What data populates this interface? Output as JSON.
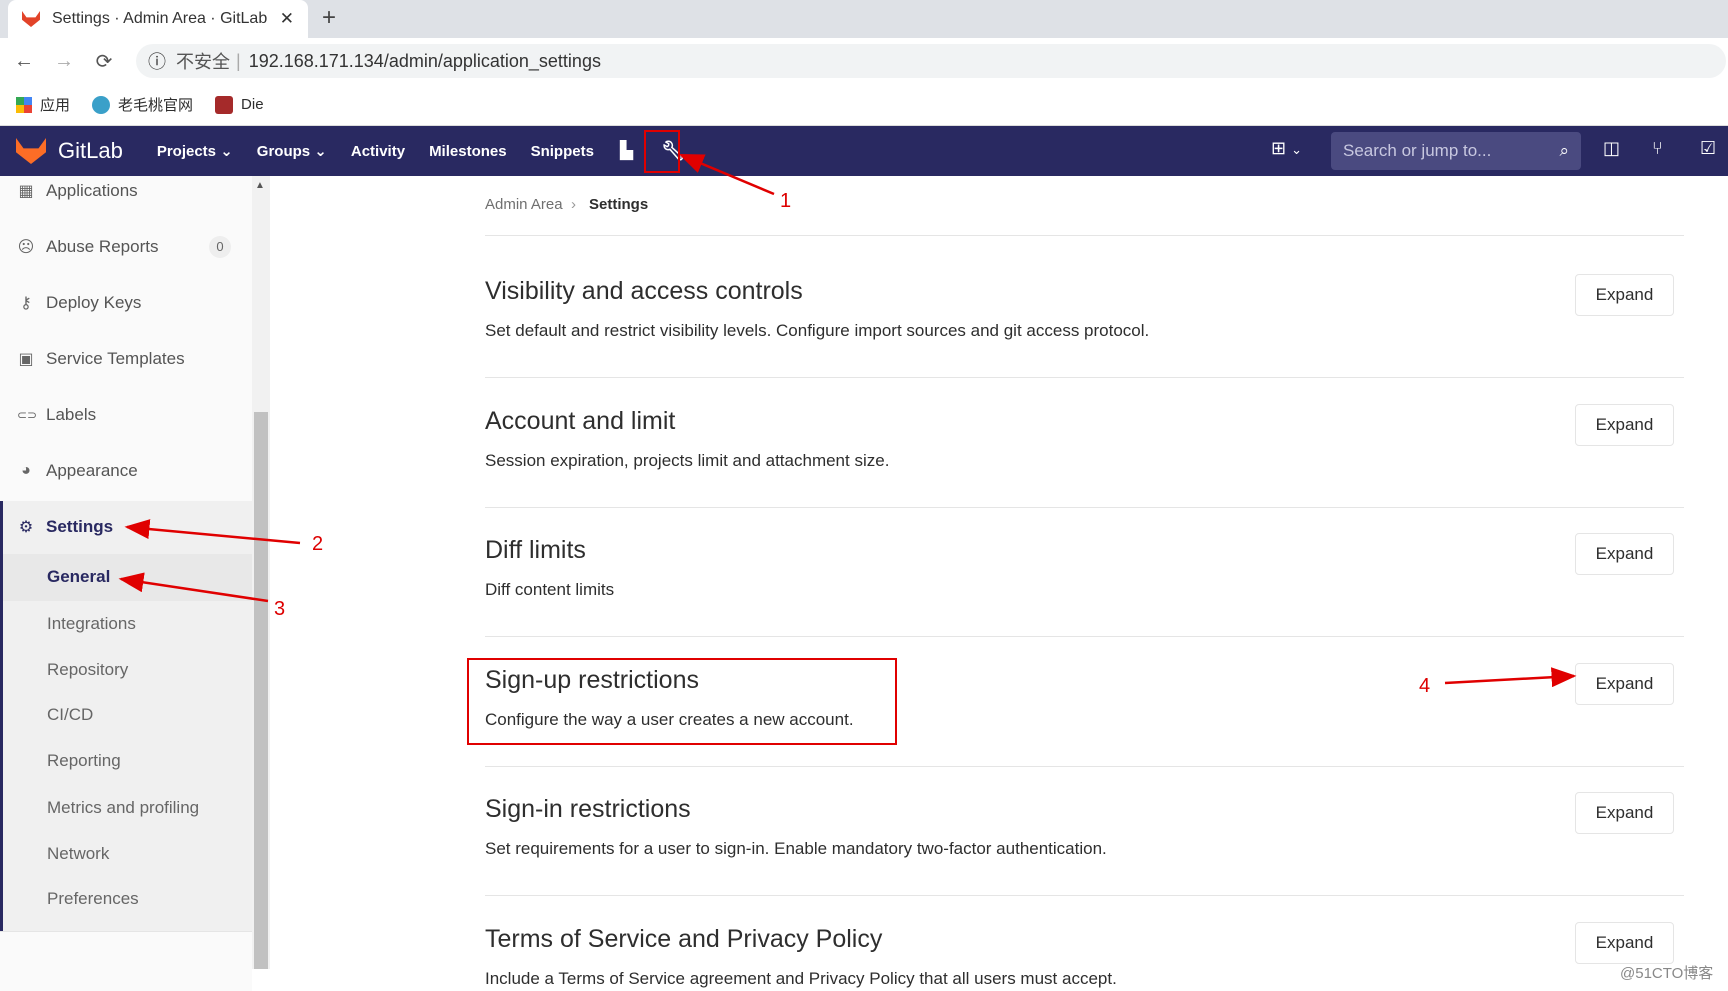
{
  "browser": {
    "tab_title": "Settings · Admin Area · GitLab",
    "close": "✕",
    "new_tab": "+",
    "back": "←",
    "forward": "→",
    "reload": "⟳",
    "security_icon": "ⓘ",
    "security_label": "不安全",
    "url": "192.168.171.134/admin/application_settings",
    "bookmarks": [
      {
        "label": "应用",
        "icon": "apps-grid-icon"
      },
      {
        "label": "老毛桃官网",
        "icon": "site-icon"
      },
      {
        "label": "Die",
        "icon": "die-icon"
      }
    ]
  },
  "navbar": {
    "brand": "GitLab",
    "items": [
      {
        "label": "Projects",
        "caret": "⌄"
      },
      {
        "label": "Groups",
        "caret": "⌄"
      },
      {
        "label": "Activity"
      },
      {
        "label": "Milestones"
      },
      {
        "label": "Snippets"
      }
    ],
    "search_placeholder": "Search or jump to...",
    "search_icon": "⌕",
    "new_icon": "⊞",
    "new_caret": "⌄"
  },
  "sidebar": {
    "items": [
      {
        "label": "Applications",
        "icon": "▦"
      },
      {
        "label": "Abuse Reports",
        "icon": "☹",
        "badge": "0"
      },
      {
        "label": "Deploy Keys",
        "icon": "⚷"
      },
      {
        "label": "Service Templates",
        "icon": "▣"
      },
      {
        "label": "Labels",
        "icon": "⊂⊃"
      },
      {
        "label": "Appearance",
        "icon": "◕"
      },
      {
        "label": "Settings",
        "icon": "⚙"
      }
    ],
    "subitems": [
      "General",
      "Integrations",
      "Repository",
      "CI/CD",
      "Reporting",
      "Metrics and profiling",
      "Network",
      "Preferences"
    ],
    "active_subitem": "General",
    "scroll_up": "▲"
  },
  "breadcrumb": {
    "parent": "Admin Area",
    "separator": "›",
    "current": "Settings"
  },
  "sections": [
    {
      "title": "Visibility and access controls",
      "description": "Set default and restrict visibility levels. Configure import sources and git access protocol.",
      "button": "Expand"
    },
    {
      "title": "Account and limit",
      "description": "Session expiration, projects limit and attachment size.",
      "button": "Expand"
    },
    {
      "title": "Diff limits",
      "description": "Diff content limits",
      "button": "Expand"
    },
    {
      "title": "Sign-up restrictions",
      "description": "Configure the way a user creates a new account.",
      "button": "Expand"
    },
    {
      "title": "Sign-in restrictions",
      "description": "Set requirements for a user to sign-in. Enable mandatory two-factor authentication.",
      "button": "Expand"
    },
    {
      "title": "Terms of Service and Privacy Policy",
      "description": "Include a Terms of Service agreement and Privacy Policy that all users must accept.",
      "button": "Expand"
    }
  ],
  "annotations": {
    "labels": [
      "1",
      "2",
      "3",
      "4"
    ],
    "color": "#e00000"
  },
  "watermark": "@51CTO博客",
  "colors": {
    "navbar": "#292961",
    "accent": "#fc6d26"
  }
}
